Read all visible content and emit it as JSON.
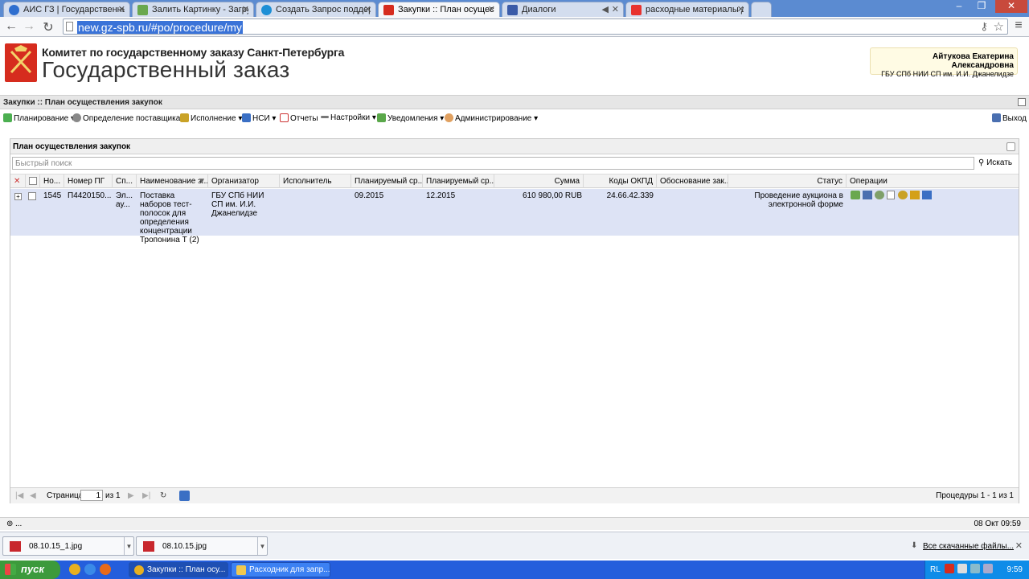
{
  "tabs": [
    {
      "title": "АИС ГЗ | Государственный"
    },
    {
      "title": "Залить Картинку - Загрузи"
    },
    {
      "title": "Создать Запрос поддержк"
    },
    {
      "title": "Закупки :: План осущест"
    },
    {
      "title": "Диалоги"
    },
    {
      "title": "расходные материалы для"
    }
  ],
  "address": {
    "url": "new.gz-spb.ru/#po/procedure/my"
  },
  "header": {
    "org_line1": "Комитет по государственному заказу Санкт-Петербурга",
    "org_line2": "Государственный заказ",
    "user_name": "Айтукова Екатерина Александровна",
    "user_org": "ГБУ СПб НИИ СП им. И.И. Джанелидзе"
  },
  "breadcrumb": "Закупки :: План осуществления закупок",
  "toolbar": {
    "items": [
      "Планирование",
      "Определение поставщика",
      "Исполнение",
      "НСИ",
      "Отчеты",
      "Настройки",
      "Уведомления",
      "Администрирование"
    ],
    "logout": "Выход"
  },
  "panel": {
    "title": "План осуществления закупок",
    "search_placeholder": "Быстрый поиск",
    "search_button": "Искать"
  },
  "table": {
    "columns": [
      "Но...",
      "Номер ПГ",
      "Сп...",
      "Наименование з...",
      "Организатор",
      "Исполнитель",
      "Планируемый ср...",
      "Планируемый ср...",
      "Сумма",
      "Коды ОКПД",
      "Обоснование зак...",
      "Статус",
      "Операции"
    ],
    "rows": [
      {
        "num": "1545",
        "pg": "П4420150...",
        "method": "Эл... ау...",
        "name": "Поставка наборов тест-полосок для определения концентрации Тропонина Т (2)",
        "organizer": "ГБУ СПб НИИ СП им. И.И. Джанелидзе",
        "executor": "",
        "plan_start": "09.2015",
        "plan_end": "12.2015",
        "sum": "610 980,00 RUB",
        "okpd": "24.66.42.339",
        "basis": "",
        "status": "Проведение аукциона в электронной форме"
      }
    ]
  },
  "pager": {
    "page_label": "Страница",
    "page_value": "1",
    "of_label": "из 1",
    "summary": "Процедуры 1 - 1 из 1"
  },
  "statusbar": {
    "left": "...",
    "right": "08 Окт 09:59"
  },
  "downloads": {
    "files": [
      "08.10.15_1.jpg",
      "08.10.15.jpg"
    ],
    "all_link": "Все скачанные файлы..."
  },
  "taskbar": {
    "start": "пуск",
    "tasks": [
      "Закупки :: План осу...",
      "Расходник для запр..."
    ],
    "lang": "RL",
    "clock": "9:59"
  },
  "colors": {
    "row_highlight": "#dde3f5",
    "taskbar": "#245edc",
    "url_select": "#3a73d8"
  }
}
